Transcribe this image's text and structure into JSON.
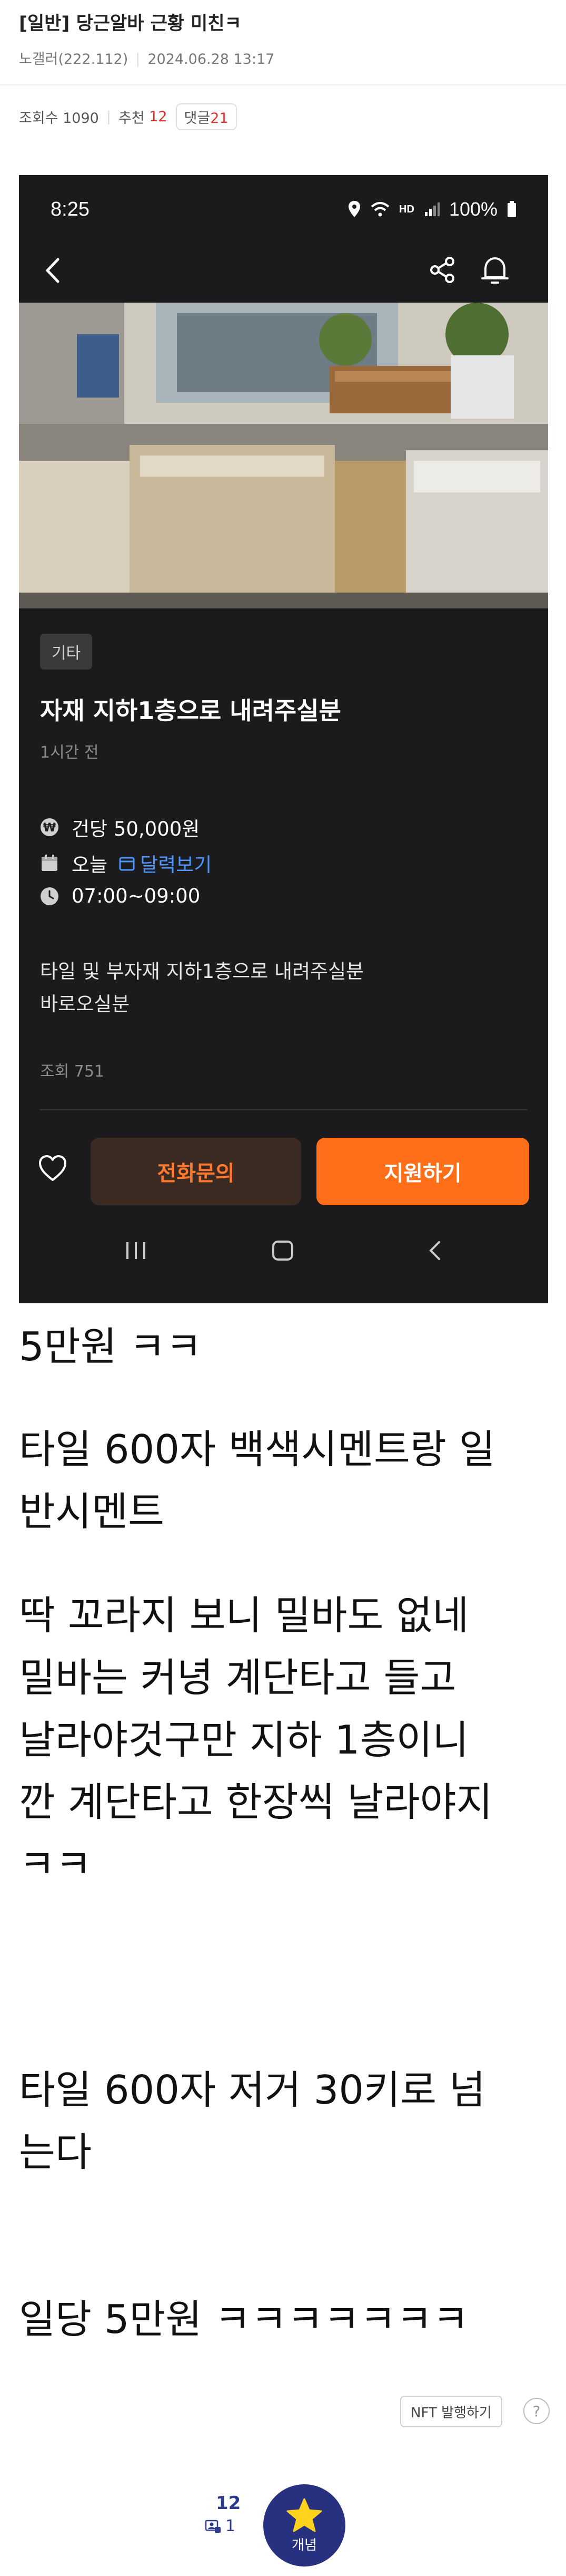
{
  "post": {
    "title": "[일반] 당근알바 근황 미친ㅋ",
    "author": "노갤러(222.112)",
    "date": "2024.06.28 13:17",
    "views_label": "조회수 1090",
    "recommend_label": "추천",
    "recommend_count": "12",
    "comment_label": "댓글",
    "comment_count": "21"
  },
  "phone": {
    "status_time": "8:25",
    "battery": "100%",
    "network": "HD",
    "tag": "기타",
    "listing_title": "자재 지하1층으로 내려주실분",
    "listing_time": "1시간 전",
    "pay": "건당 50,000원",
    "date": "오늘",
    "calendar_link": "달력보기",
    "hours": "07:00~09:00",
    "desc_line1": "타일 및 부자재 지하1층으로 내려주실분",
    "desc_line2": "바로오실분",
    "views": "조회 751",
    "call_button": "전화문의",
    "apply_button": "지원하기",
    "icons": [
      "back-icon",
      "share-icon",
      "bell-icon",
      "heart-icon",
      "won-icon",
      "calendar-icon",
      "clock-icon"
    ]
  },
  "body": {
    "p1": "5만원 ㅋㅋ",
    "p2_line1": "타일 600자 백색시멘트랑 일",
    "p2_line2": "반시멘트",
    "p3_line1": "딱 꼬라지 보니 밀바도 없네",
    "p3_line2": "밀바는 커녕 계단타고 들고",
    "p3_line3": "날라야것구만 지하 1층이니",
    "p3_line4": "깐 계단타고 한장씩 날라야지",
    "p3_line5": "ㅋㅋ",
    "p4_line1": "타일 600자 저거 30키로 넘",
    "p4_line2": "는다",
    "p5": "일당 5만원 ㅋㅋㅋㅋㅋㅋㅋ"
  },
  "footer": {
    "nft_button": "NFT 발행하기",
    "help": "?",
    "recommend_count": "12",
    "fixed_recommend_count": "1",
    "recommend_button": "개념"
  },
  "colors": {
    "accent_orange": "#ff6f1a",
    "link_blue": "#4c95ff",
    "recommend_navy": "#27317f",
    "comment_red": "#d33333"
  }
}
